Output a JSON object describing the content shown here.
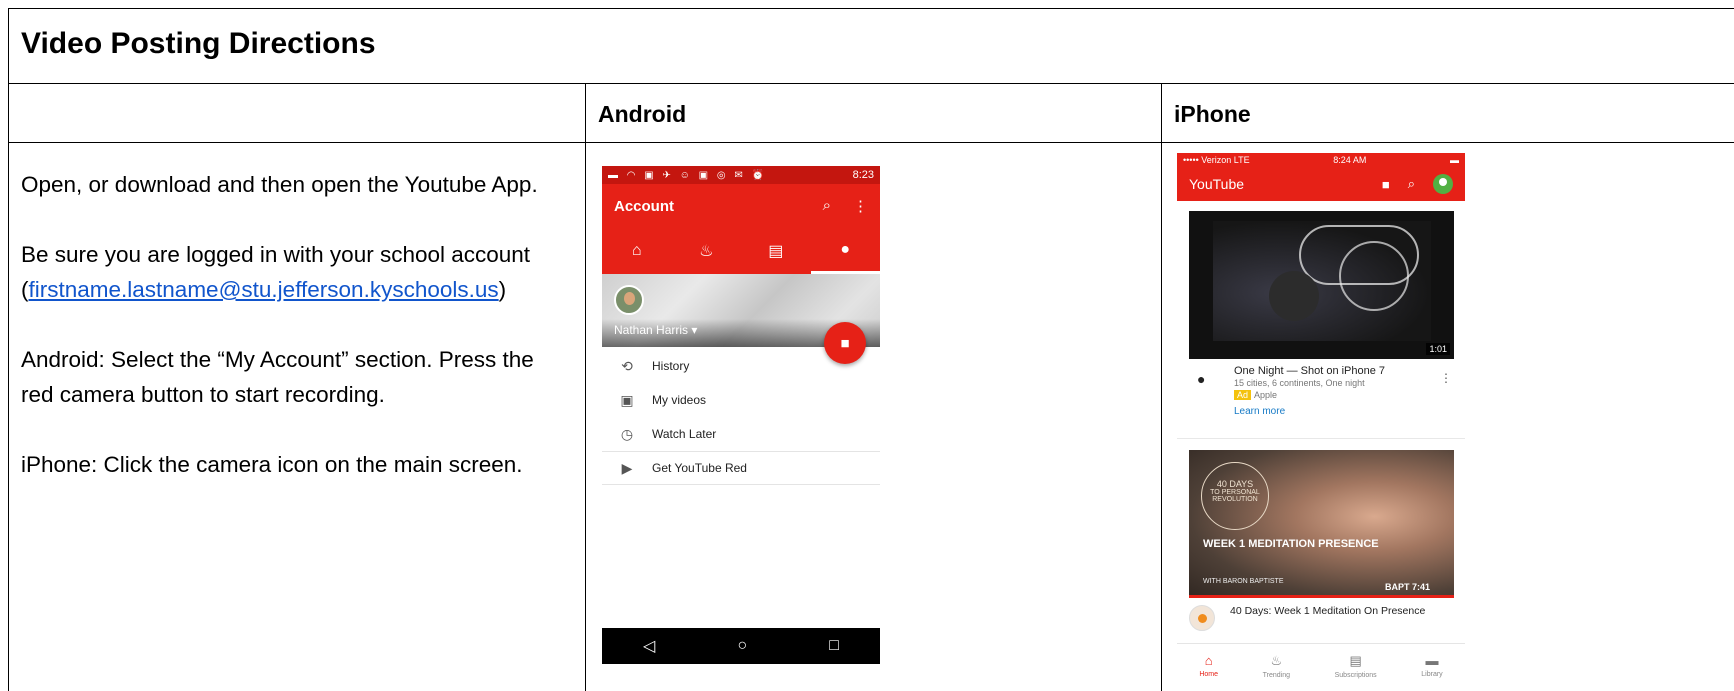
{
  "doc": {
    "title": "Video Posting Directions",
    "headers": {
      "blank": "",
      "android": "Android",
      "iphone": "iPhone"
    },
    "instructions": {
      "p1": "Open, or download and then open the Youtube App.",
      "p2_prefix": "Be sure you are logged in with your school account (",
      "p2_link": "firstname.lastname@stu.jefferson.kyschools.us",
      "p2_suffix": ")",
      "p3": "Android: Select the “My Account” section. Press the red camera button to start recording.",
      "p4": "iPhone: Click the camera icon on the main screen."
    },
    "link_color": "#1155cc"
  },
  "android": {
    "status_time": "8:23",
    "appbar_title": "Account",
    "user_name": "Nathan Harris",
    "menu": [
      "History",
      "My videos",
      "Watch Later",
      "Get YouTube Red"
    ],
    "accent": "#e62117"
  },
  "iphone": {
    "carrier": "••••• Verizon  LTE",
    "time": "8:24 AM",
    "app_title": "YouTube",
    "video1": {
      "duration": "1:01",
      "title": "One Night — Shot on iPhone 7",
      "subtitle": "15 cities, 6 continents, One night",
      "ad_badge": "Ad",
      "advertiser": "Apple",
      "cta": "Learn more"
    },
    "video2": {
      "ring_top": "40 DAYS",
      "ring_sub": "TO PERSONAL REVOLUTION",
      "overlay": "WEEK 1 MEDITATION PRESENCE",
      "with": "WITH BARON BAPTISTE",
      "tag": "BAPT 7:41",
      "title": "40 Days: Week 1 Meditation On Presence"
    },
    "tabs": [
      "Home",
      "Trending",
      "Subscriptions",
      "Library"
    ]
  }
}
